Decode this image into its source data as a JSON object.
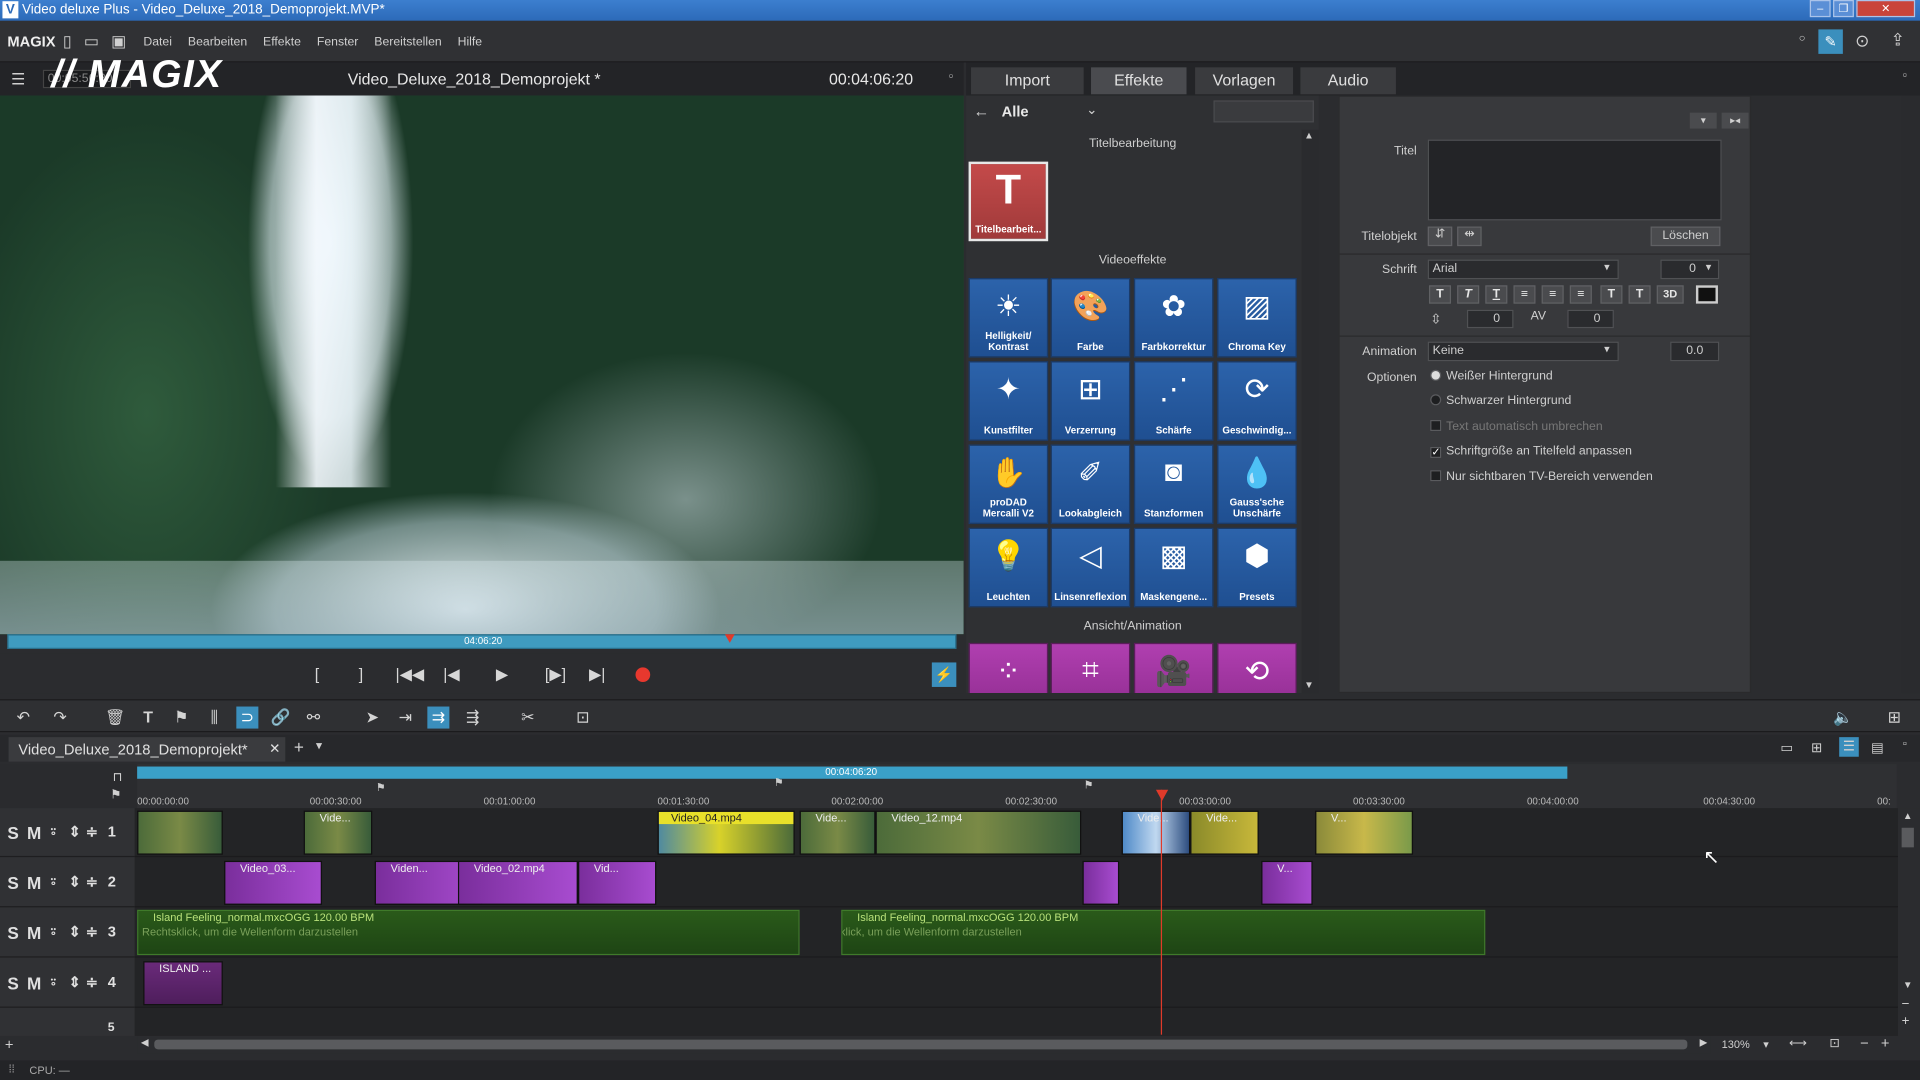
{
  "window": {
    "title": "Video deluxe Plus - Video_Deluxe_2018_Demoprojekt.MVP*"
  },
  "menu": {
    "brand": "MAGIX",
    "items": [
      "Datei",
      "Bearbeiten",
      "Effekte",
      "Fenster",
      "Bereitstellen",
      "Hilfe"
    ]
  },
  "preview": {
    "logo": "// MAGIX",
    "timecode_left": "00:05:56:20",
    "project_title": "Video_Deluxe_2018_Demoprojekt *",
    "timecode_right": "00:04:06:20",
    "scrub_time": "04:06:20"
  },
  "media_tabs": [
    "Import",
    "Effekte",
    "Vorlagen",
    "Audio"
  ],
  "effects": {
    "filter": "Alle",
    "title_section": "Titelbearbeitung",
    "title_tile": "Titelbearbeit...",
    "video_section": "Videoeffekte",
    "video_tiles": [
      "Helligkeit/ Kontrast",
      "Farbe",
      "Farbkorrektur",
      "Chroma Key",
      "Kunstfilter",
      "Verzerrung",
      "Schärfe",
      "Geschwindig...",
      "proDAD Mercalli V2",
      "Lookabgleich",
      "Stanzformen",
      "Gauss'sche Unschärfe",
      "Leuchten",
      "Linsenreflexion",
      "Maskengene...",
      "Presets"
    ],
    "anim_section": "Ansicht/Animation"
  },
  "properties": {
    "title_label": "Titel",
    "titleobj_label": "Titelobjekt",
    "delete_label": "Löschen",
    "font_label": "Schrift",
    "font_value": "Arial",
    "font_size": "0",
    "line_spacing": "0",
    "char_spacing": "0",
    "format_buttons": [
      "T",
      "T",
      "T",
      "≡",
      "≡",
      "≡",
      "T",
      "T",
      "3D"
    ],
    "animation_label": "Animation",
    "animation_value": "Keine",
    "animation_num": "0.0",
    "options_label": "Optionen",
    "options": [
      {
        "label": "Weißer Hintergrund",
        "type": "radio",
        "checked": true,
        "enabled": true
      },
      {
        "label": "Schwarzer Hintergrund",
        "type": "radio",
        "checked": false,
        "enabled": true
      },
      {
        "label": "Text automatisch umbrechen",
        "type": "check",
        "checked": false,
        "enabled": false
      },
      {
        "label": "Schriftgröße an Titelfeld anpassen",
        "type": "check",
        "checked": true,
        "enabled": true
      },
      {
        "label": "Nur sichtbaren TV-Bereich verwenden",
        "type": "check",
        "checked": false,
        "enabled": true
      }
    ]
  },
  "timeline": {
    "project_tab": "Video_Deluxe_2018_Demoprojekt*",
    "ruler_time": "00:04:06:20",
    "ticks": [
      "00:00:00:00",
      "00:00:30:00",
      "00:01:00:00",
      "00:01:30:00",
      "00:02:00:00",
      "00:02:30:00",
      "00:03:00:00",
      "00:03:30:00",
      "00:04:00:00",
      "00:04:30:00",
      "00:"
    ],
    "tracks": [
      "1",
      "2",
      "3",
      "4",
      "5"
    ],
    "clips": {
      "t1": [
        "Vide...",
        "Video_04.mp4",
        "Vide...",
        "Video_12.mp4",
        "Vide...",
        "Vide...",
        "V..."
      ],
      "t2": [
        "Video_03...",
        "Viden...",
        "Video_02.mp4",
        "Vid...",
        "V..."
      ],
      "t3": [
        "Island Feeling_normal.mxcOGG  120.00 BPM",
        "Island Feeling_normal.mxcOGG  120.00 BPM"
      ],
      "t3_hint": [
        "Rechtsklick, um die Wellenform darzustellen",
        "Rechtsklick, um die Wellenform darzustellen"
      ],
      "t4": [
        "ISLAND ..."
      ]
    },
    "zoom": "130%"
  },
  "status": {
    "cpu": "CPU: —"
  }
}
